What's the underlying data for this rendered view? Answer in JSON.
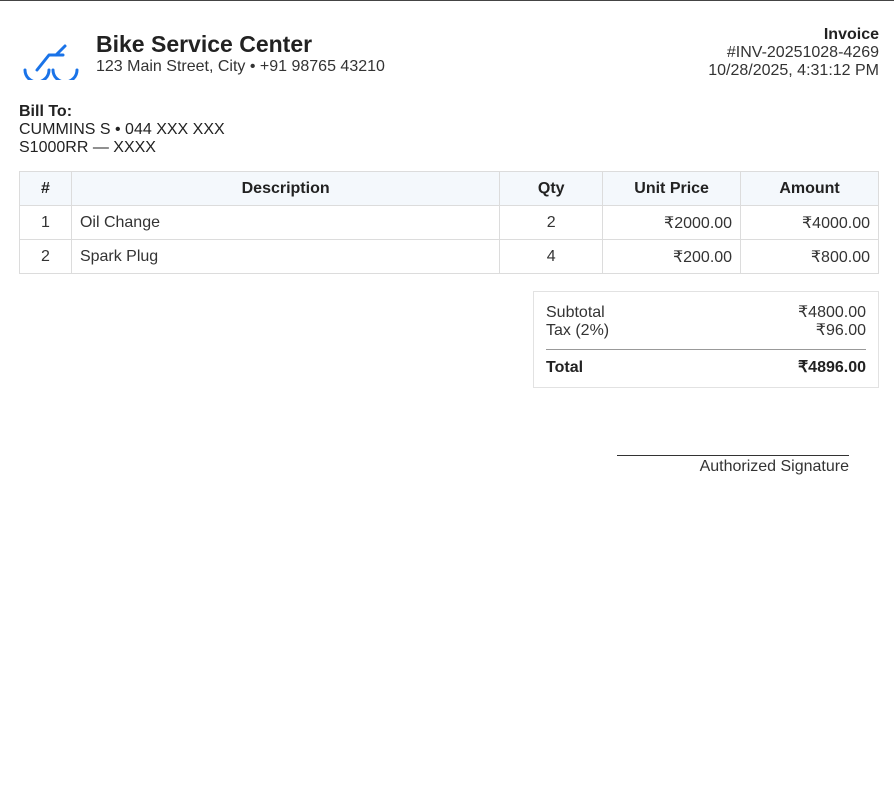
{
  "company": {
    "name": "Bike Service Center",
    "address": "123 Main Street, City • +91 98765 43210",
    "logo_icon": "bicycle-icon",
    "accent_color": "#1a73e8"
  },
  "invoice": {
    "title": "Invoice",
    "number": "#INV-20251028-4269",
    "datetime": "10/28/2025, 4:31:12 PM"
  },
  "bill_to": {
    "label": "Bill To:",
    "customer": "CUMMINS S • 044 XXX XXX",
    "vehicle": "S1000RR — XXXX"
  },
  "items_table": {
    "headers": [
      "#",
      "Description",
      "Qty",
      "Unit Price",
      "Amount"
    ],
    "rows": [
      [
        "1",
        "Oil Change",
        "2",
        "₹2000.00",
        "₹4000.00"
      ],
      [
        "2",
        "Spark Plug",
        "4",
        "₹200.00",
        "₹800.00"
      ]
    ]
  },
  "totals": {
    "subtotal_label": "Subtotal",
    "subtotal_value": "₹4800.00",
    "tax_label": "Tax (2%)",
    "tax_value": "₹96.00",
    "total_label": "Total",
    "total_value": "₹4896.00"
  },
  "signature": {
    "label": "Authorized Signature"
  }
}
